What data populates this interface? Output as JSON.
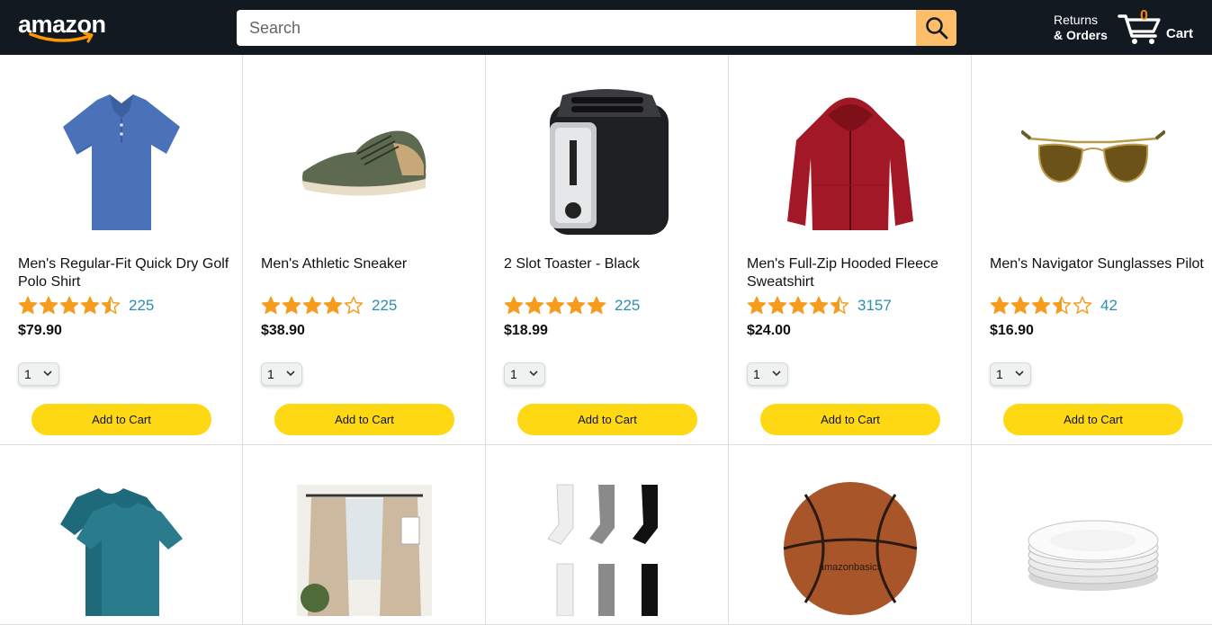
{
  "header": {
    "logo_text": "amazon",
    "search_placeholder": "Search",
    "returns_line1": "Returns",
    "returns_line2": "& Orders",
    "cart_count": "0",
    "cart_label": "Cart",
    "colors": {
      "bar": "#131921",
      "search_button": "#febd69",
      "cart_count": "#f08804",
      "logo_smile": "#ff9900"
    }
  },
  "products": [
    {
      "name": "Men's Regular-Fit Quick Dry Golf Polo Shirt",
      "rating": 4.5,
      "rating_count": "225",
      "price": "$79.90",
      "qty": "1",
      "add_label": "Add to Cart",
      "image": "polo-shirt"
    },
    {
      "name": "Men's Athletic Sneaker",
      "rating": 4.0,
      "rating_count": "225",
      "price": "$38.90",
      "qty": "1",
      "add_label": "Add to Cart",
      "image": "sneaker"
    },
    {
      "name": "2 Slot Toaster - Black",
      "rating": 5.0,
      "rating_count": "225",
      "price": "$18.99",
      "qty": "1",
      "add_label": "Add to Cart",
      "image": "toaster"
    },
    {
      "name": "Men's Full-Zip Hooded Fleece Sweatshirt",
      "rating": 4.5,
      "rating_count": "3157",
      "price": "$24.00",
      "qty": "1",
      "add_label": "Add to Cart",
      "image": "hoodie"
    },
    {
      "name": "Men's Navigator Sunglasses Pilot",
      "rating": 3.5,
      "rating_count": "42",
      "price": "$16.90",
      "qty": "1",
      "add_label": "Add to Cart",
      "image": "sunglasses"
    }
  ],
  "products_row2": [
    {
      "image": "tshirts"
    },
    {
      "image": "curtains"
    },
    {
      "image": "socks"
    },
    {
      "image": "basketball"
    },
    {
      "image": "plates"
    }
  ],
  "basketball_text": "amazonbasics",
  "colors": {
    "star": "#f79b1c",
    "add_button": "#ffd814",
    "rating_count": "#2a8fb0"
  }
}
